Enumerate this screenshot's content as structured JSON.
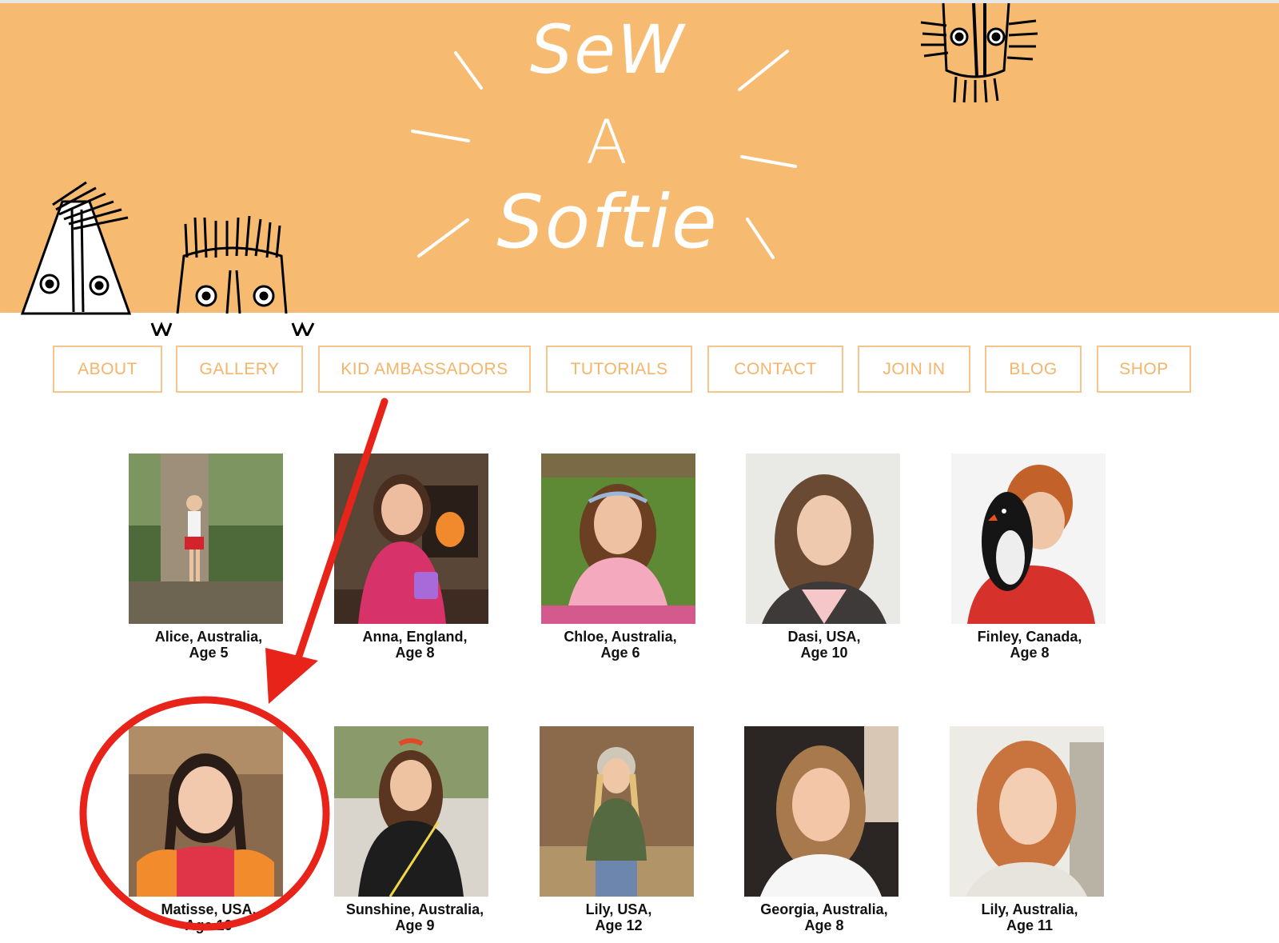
{
  "site": {
    "logo_lines": [
      "SeW",
      "A",
      "Softie"
    ]
  },
  "nav": {
    "items": [
      {
        "label": "ABOUT"
      },
      {
        "label": "GALLERY"
      },
      {
        "label": "KID AMBASSADORS"
      },
      {
        "label": "TUTORIALS"
      },
      {
        "label": "CONTACT"
      },
      {
        "label": "JOIN IN"
      },
      {
        "label": "BLOG"
      },
      {
        "label": "SHOP"
      }
    ],
    "text_color": "#f4b46a",
    "border_color": "#f6c58a"
  },
  "gallery": {
    "ambassadors": [
      {
        "name_line": "Alice, Australia,",
        "age_line": "Age 5"
      },
      {
        "name_line": "Anna, England,",
        "age_line": "Age 8"
      },
      {
        "name_line": "Chloe, Australia,",
        "age_line": "Age 6"
      },
      {
        "name_line": "Dasi, USA,",
        "age_line": "Age 10"
      },
      {
        "name_line": "Finley, Canada,",
        "age_line": "Age 8"
      },
      {
        "name_line": "Matisse, USA,",
        "age_line": "Age 10"
      },
      {
        "name_line": "Sunshine, Australia,",
        "age_line": "Age 9"
      },
      {
        "name_line": "Lily, USA,",
        "age_line": "Age 12"
      },
      {
        "name_line": "Georgia, Australia,",
        "age_line": "Age 8"
      },
      {
        "name_line": "Lily, Australia,",
        "age_line": "Age 11"
      }
    ]
  },
  "colors": {
    "banner": "#f6bb71",
    "annotation": "#e8231a"
  },
  "icons": [
    "doodle-creature-icon",
    "annotation-arrow-icon",
    "annotation-circle-icon"
  ]
}
